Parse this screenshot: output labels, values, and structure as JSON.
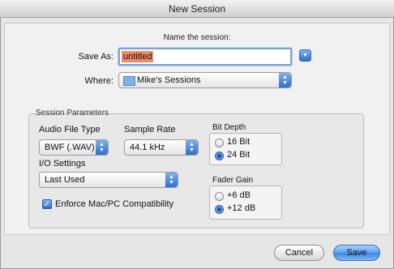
{
  "window": {
    "title": "New Session"
  },
  "prompt": "Name the session:",
  "save_as": {
    "label": "Save As:",
    "value": "untitled"
  },
  "where": {
    "label": "Where:",
    "value": "Mike's Sessions"
  },
  "session_parameters": {
    "title": "Session Parameters",
    "audio_file_type": {
      "label": "Audio File Type",
      "value": "BWF (.WAV)"
    },
    "sample_rate": {
      "label": "Sample Rate",
      "value": "44.1 kHz"
    },
    "io_settings": {
      "label": "I/O Settings",
      "value": "Last Used"
    },
    "bit_depth": {
      "label": "Bit Depth",
      "options": [
        "16 Bit",
        "24 Bit"
      ],
      "selected": "24 Bit"
    },
    "fader_gain": {
      "label": "Fader Gain",
      "options": [
        "+6 dB",
        "+12 dB"
      ],
      "selected": "+12 dB"
    },
    "enforce_compat": {
      "label": "Enforce Mac/PC Compatibility",
      "checked": true
    }
  },
  "buttons": {
    "cancel": "Cancel",
    "save": "Save"
  },
  "colors": {
    "accent": "#3a86e3",
    "selection": "#f08a66"
  }
}
